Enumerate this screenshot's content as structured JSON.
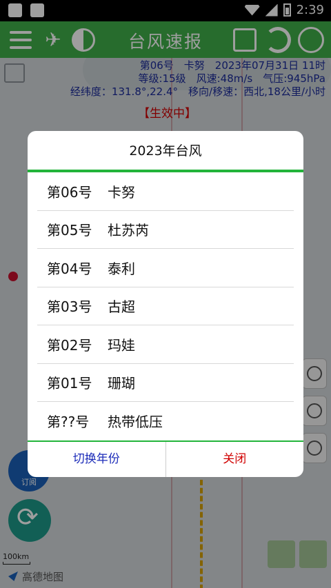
{
  "status_bar": {
    "time": "2:39"
  },
  "header": {
    "title": "台风速报"
  },
  "info": {
    "line1": "第06号　卡努　2023年07月31日 11时",
    "line2": "等级:15级　风速:48m/s　气压:945hPa",
    "line3": "经纬度：131.8°,22.4°　移向/移速：西北,18公里/小时",
    "effective": "【生效中】"
  },
  "map": {
    "subscribe_label": "订阅",
    "scale_label": "100km",
    "attribution": "高德地图"
  },
  "dialog": {
    "title": "2023年台风",
    "items": [
      {
        "num": "第06号",
        "name": "卡努"
      },
      {
        "num": "第05号",
        "name": "杜苏芮"
      },
      {
        "num": "第04号",
        "name": "泰利"
      },
      {
        "num": "第03号",
        "name": "古超"
      },
      {
        "num": "第02号",
        "name": "玛娃"
      },
      {
        "num": "第01号",
        "name": "珊瑚"
      },
      {
        "num": "第??号",
        "name": "热带低压"
      }
    ],
    "switch_year": "切换年份",
    "close": "关闭"
  },
  "colors": {
    "header_green": "#3fae49",
    "accent_line": "#22b43a",
    "info_blue": "#1a2a9a",
    "close_red": "#d00000"
  }
}
